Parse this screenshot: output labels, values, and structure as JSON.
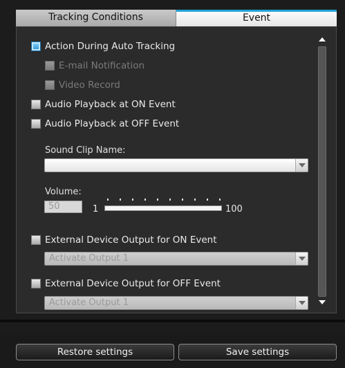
{
  "tabs": [
    {
      "label": "Tracking Conditions",
      "active": false
    },
    {
      "label": "Event",
      "active": true
    }
  ],
  "options": {
    "action_during_auto_tracking": {
      "label": "Action During Auto Tracking",
      "checked": true
    },
    "email_notification": {
      "label": "E-mail Notification",
      "checked": false,
      "enabled": false
    },
    "video_record": {
      "label": "Video Record",
      "checked": false,
      "enabled": false
    },
    "audio_on_event": {
      "label": "Audio Playback at ON Event",
      "checked": false
    },
    "audio_off_event": {
      "label": "Audio Playback at OFF Event",
      "checked": false
    },
    "external_on_event": {
      "label": "External Device Output for ON Event",
      "checked": false
    },
    "external_off_event": {
      "label": "External Device Output for OFF Event",
      "checked": false
    }
  },
  "sound_clip": {
    "label": "Sound Clip Name:",
    "value": ""
  },
  "volume": {
    "label": "Volume:",
    "value": "50",
    "min_label": "1",
    "max_label": "100",
    "level": 1.0
  },
  "external_on_output": {
    "value": "Activate Output 1"
  },
  "external_off_output": {
    "value": "Activate Output 1"
  },
  "buttons": {
    "restore": "Restore settings",
    "save": "Save settings"
  },
  "colors": {
    "accent_tab": "#1fa3d6",
    "background": "#1c1c1c",
    "panel": "#2b2b2b"
  },
  "icons": {
    "checkbox": "checkbox-icon",
    "dropdown": "chevron-down-icon",
    "scroll_up": "arrow-up-icon",
    "scroll_down": "arrow-down-icon"
  }
}
